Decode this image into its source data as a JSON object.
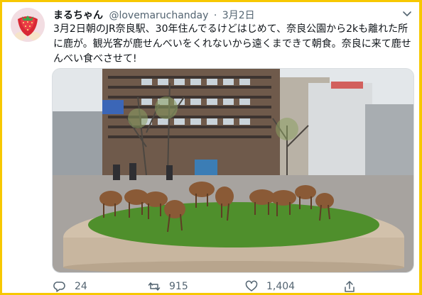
{
  "tweet": {
    "display_name": "まるちゃん",
    "handle": "@lovemaruchanday",
    "separator": "·",
    "date": "3月2日",
    "text": "3月2日朝のJR奈良駅、30年住んでるけどはじめて、奈良公園から2kも離れた所に鹿が。観光客が鹿せんべいをくれないから遠くまできて朝食。奈良に来て鹿せんべい食べさせて!",
    "photo_description_icon": "deer-grazing-photo"
  },
  "actions": {
    "reply_count": "24",
    "retweet_count": "915",
    "like_count": "1,404"
  },
  "colors": {
    "frame": "#f7c800",
    "text": "#0f1419",
    "secondary": "#536471"
  }
}
